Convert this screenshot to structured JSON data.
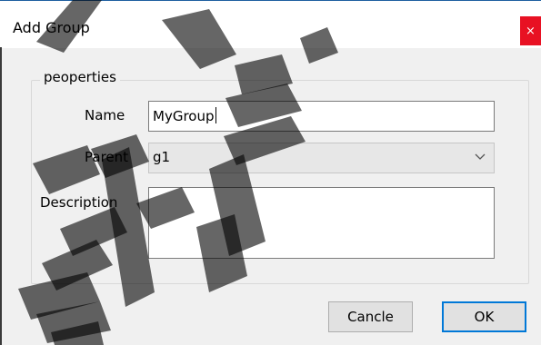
{
  "dialog": {
    "title": "Add Group",
    "close_glyph": "×"
  },
  "group": {
    "legend": "peoperties"
  },
  "fields": {
    "name_label": "Name",
    "name_value": "MyGroup",
    "parent_label": "Parent",
    "parent_value": "g1",
    "description_label": "Description",
    "description_value": ""
  },
  "buttons": {
    "cancel_label": "Cancle",
    "ok_label": "OK"
  },
  "colors": {
    "close_button": "#e81123",
    "ok_border": "#0078d7",
    "watermark": "#000000"
  }
}
